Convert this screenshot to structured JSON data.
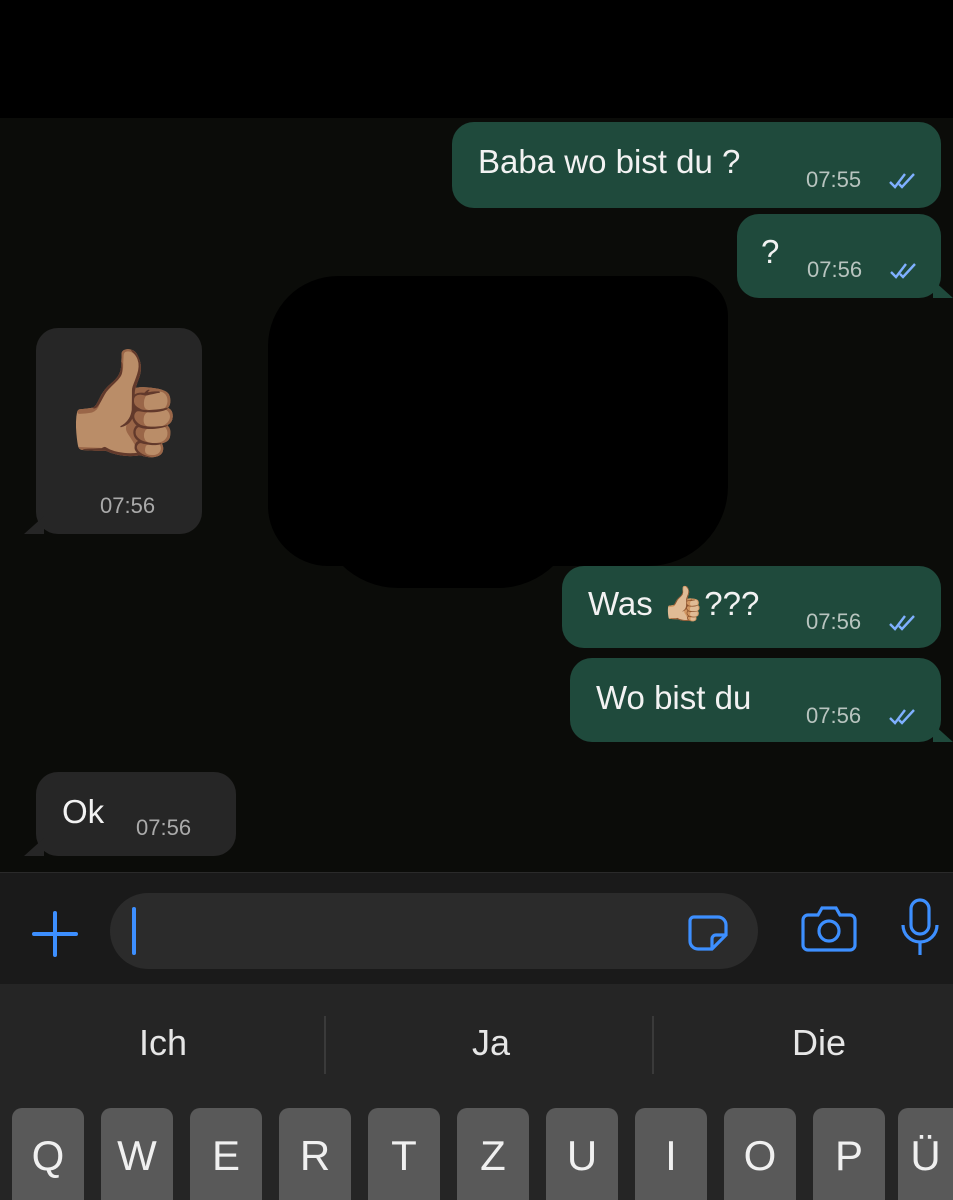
{
  "messages": [
    {
      "direction": "out",
      "text": "Baba wo bist du ?",
      "time": "07:55",
      "read": true
    },
    {
      "direction": "out",
      "text": "?",
      "time": "07:56",
      "read": true
    },
    {
      "direction": "in",
      "emoji": "👍🏽",
      "time": "07:56"
    },
    {
      "direction": "out",
      "text_before": "Was ",
      "emoji": "👍🏼",
      "text_after": "???",
      "time": "07:56",
      "read": true
    },
    {
      "direction": "out",
      "text": "Wo bist du",
      "time": "07:56",
      "read": true
    },
    {
      "direction": "in",
      "text": "Ok",
      "time": "07:56"
    }
  ],
  "composer": {
    "value": "",
    "icons": [
      "plus-icon",
      "sticker-icon",
      "camera-icon",
      "microphone-icon"
    ]
  },
  "keyboard": {
    "suggestions": [
      "Ich",
      "Ja",
      "Die"
    ],
    "keys": [
      "Q",
      "W",
      "E",
      "R",
      "T",
      "Z",
      "U",
      "I",
      "O",
      "P",
      "Ü"
    ]
  },
  "colors": {
    "outgoing_bubble": "#1f4a3c",
    "incoming_bubble": "#262626",
    "read_ticks": "#7fb0ff",
    "accent": "#3d8fff"
  }
}
